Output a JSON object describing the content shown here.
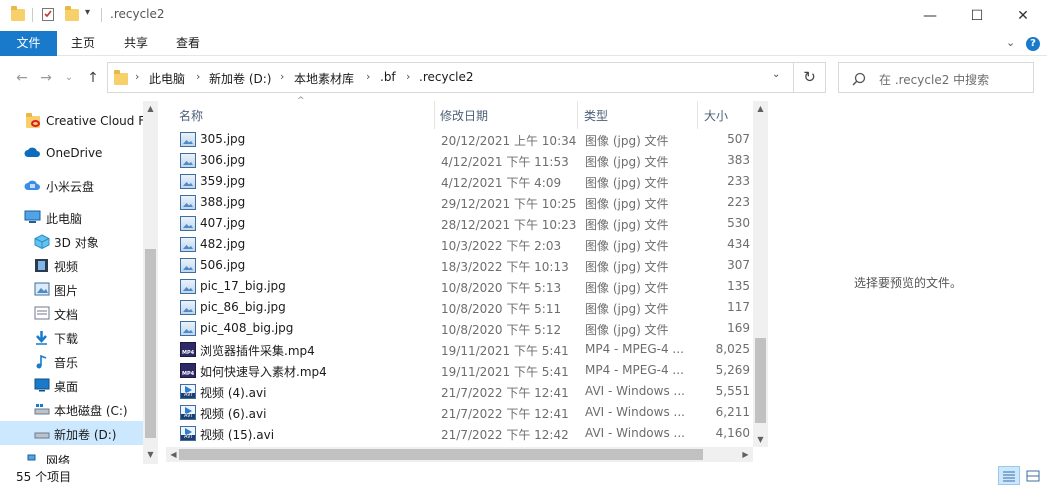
{
  "window": {
    "title": ".recycle2",
    "minimize": "—",
    "maximize": "☐",
    "close": "✕"
  },
  "ribbon": {
    "tabs": [
      "文件",
      "主页",
      "共享",
      "查看"
    ],
    "expand": "⌄",
    "help": "?"
  },
  "nav": {
    "back": "←",
    "forward": "→",
    "recent": "⌄",
    "up": "↑",
    "breadcrumb": [
      "此电脑",
      "新加卷 (D:)",
      "本地素材库",
      ".bf",
      ".recycle2"
    ],
    "dropdown": "⌄",
    "refresh": "↻",
    "search_placeholder": "在 .recycle2 中搜索"
  },
  "navpane": {
    "items": [
      {
        "label": "Creative Cloud F",
        "icon": "creative-cloud-icon"
      },
      {
        "label": "OneDrive",
        "icon": "onedrive-icon"
      },
      {
        "label": "小米云盘",
        "icon": "xiaomi-cloud-icon"
      },
      {
        "label": "此电脑",
        "icon": "this-pc-icon"
      },
      {
        "label": "3D 对象",
        "icon": "3d-objects-icon"
      },
      {
        "label": "视频",
        "icon": "videos-icon"
      },
      {
        "label": "图片",
        "icon": "pictures-icon"
      },
      {
        "label": "文档",
        "icon": "documents-icon"
      },
      {
        "label": "下载",
        "icon": "downloads-icon"
      },
      {
        "label": "音乐",
        "icon": "music-icon"
      },
      {
        "label": "桌面",
        "icon": "desktop-icon"
      },
      {
        "label": "本地磁盘 (C:)",
        "icon": "local-disk-icon"
      },
      {
        "label": "新加卷 (D:)",
        "icon": "drive-icon"
      },
      {
        "label": "网络",
        "icon": "network-icon"
      }
    ]
  },
  "filelist": {
    "columns": {
      "name": "名称",
      "date": "修改日期",
      "type": "类型",
      "size": "大小"
    },
    "rows": [
      {
        "name": "305.jpg",
        "date": "20/12/2021 上午 10:34",
        "type": "图像 (jpg) 文件",
        "size": "507",
        "kind": "jpg"
      },
      {
        "name": "306.jpg",
        "date": "4/12/2021 下午 11:53",
        "type": "图像 (jpg) 文件",
        "size": "383",
        "kind": "jpg"
      },
      {
        "name": "359.jpg",
        "date": "4/12/2021 下午 4:09",
        "type": "图像 (jpg) 文件",
        "size": "233",
        "kind": "jpg"
      },
      {
        "name": "388.jpg",
        "date": "29/12/2021 下午 10:25",
        "type": "图像 (jpg) 文件",
        "size": "223",
        "kind": "jpg"
      },
      {
        "name": "407.jpg",
        "date": "28/12/2021 下午 10:23",
        "type": "图像 (jpg) 文件",
        "size": "530",
        "kind": "jpg"
      },
      {
        "name": "482.jpg",
        "date": "10/3/2022 下午 2:03",
        "type": "图像 (jpg) 文件",
        "size": "434",
        "kind": "jpg"
      },
      {
        "name": "506.jpg",
        "date": "18/3/2022 下午 10:13",
        "type": "图像 (jpg) 文件",
        "size": "307",
        "kind": "jpg"
      },
      {
        "name": "pic_17_big.jpg",
        "date": "10/8/2020 下午 5:13",
        "type": "图像 (jpg) 文件",
        "size": "135",
        "kind": "jpg"
      },
      {
        "name": "pic_86_big.jpg",
        "date": "10/8/2020 下午 5:11",
        "type": "图像 (jpg) 文件",
        "size": "117",
        "kind": "jpg"
      },
      {
        "name": "pic_408_big.jpg",
        "date": "10/8/2020 下午 5:12",
        "type": "图像 (jpg) 文件",
        "size": "169",
        "kind": "jpg"
      },
      {
        "name": "浏览器插件采集.mp4",
        "date": "19/11/2021 下午 5:41",
        "type": "MP4 - MPEG-4 ...",
        "size": "8,025",
        "kind": "mp4"
      },
      {
        "name": "如何快速导入素材.mp4",
        "date": "19/11/2021 下午 5:41",
        "type": "MP4 - MPEG-4 ...",
        "size": "5,269",
        "kind": "mp4"
      },
      {
        "name": "视频 (4).avi",
        "date": "21/7/2022 下午 12:41",
        "type": "AVI - Windows ...",
        "size": "5,551",
        "kind": "avi"
      },
      {
        "name": "视频 (6).avi",
        "date": "21/7/2022 下午 12:41",
        "type": "AVI - Windows ...",
        "size": "6,211",
        "kind": "avi"
      },
      {
        "name": "视频 (15).avi",
        "date": "21/7/2022 下午 12:42",
        "type": "AVI - Windows ...",
        "size": "4,160",
        "kind": "avi"
      }
    ]
  },
  "preview": {
    "empty_text": "选择要预览的文件。"
  },
  "status": {
    "item_count": "55 个项目"
  },
  "colors": {
    "accent": "#1979ca",
    "selection": "#cce8ff"
  }
}
